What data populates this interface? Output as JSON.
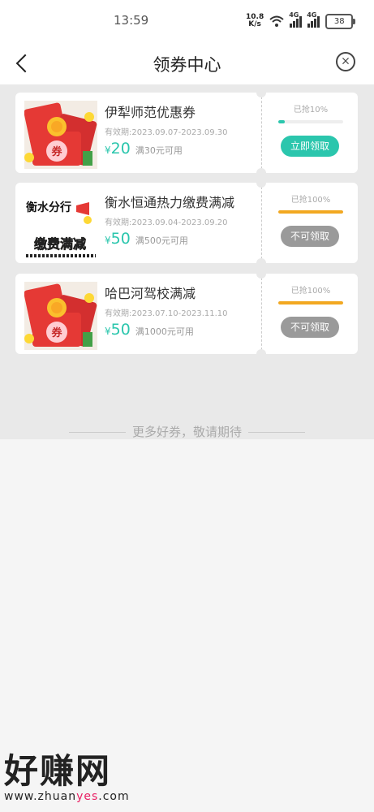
{
  "status_bar": {
    "time": "13:59",
    "net_speed_value": "10.8",
    "net_speed_unit": "K/s",
    "signal1_label": "4G",
    "signal2_label": "4G",
    "battery": "38"
  },
  "nav": {
    "title": "领券中心",
    "back_icon": "chevron-left-icon",
    "close_icon": "close-circle-icon"
  },
  "coupons": [
    {
      "title": "伊犁师范优惠券",
      "date_label": "有效期:",
      "date_range": "2023.09.07-2023.09.30",
      "currency": "¥",
      "amount": "20",
      "condition": "满30元可用",
      "taken_label": "已抢10%",
      "taken_fraction": 0.1,
      "action_label": "立即领取",
      "action_color": "#2bc6ad",
      "bar_color": "#2bc6ad",
      "image": "red-envelope"
    },
    {
      "title": "衡水恒通热力缴费满减",
      "date_label": "有效期:",
      "date_range": "2023.09.04-2023.09.20",
      "currency": "¥",
      "amount": "50",
      "condition": "满500元可用",
      "taken_label": "已抢100%",
      "taken_fraction": 1.0,
      "action_label": "不可领取",
      "action_color": "#9a9a9a",
      "bar_color": "#f2a821",
      "image": "hengshui-banner",
      "image_text1": "衡水分行",
      "image_text2": "缴费满减"
    },
    {
      "title": "哈巴河驾校满减",
      "date_label": "有效期:",
      "date_range": "2023.07.10-2023.11.10",
      "currency": "¥",
      "amount": "50",
      "condition": "满1000元可用",
      "taken_label": "已抢100%",
      "taken_fraction": 1.0,
      "action_label": "不可领取",
      "action_color": "#9a9a9a",
      "bar_color": "#f2a821",
      "image": "red-envelope"
    }
  ],
  "footer_note": "更多好券，敬请期待",
  "watermark": {
    "big": "好赚网",
    "small_a": "www.zhuan",
    "small_accent": "yes",
    "small_b": ".com"
  },
  "colors": {
    "accent": "#2bc6ad",
    "full": "#f2a821",
    "disabled": "#9a9a9a"
  }
}
